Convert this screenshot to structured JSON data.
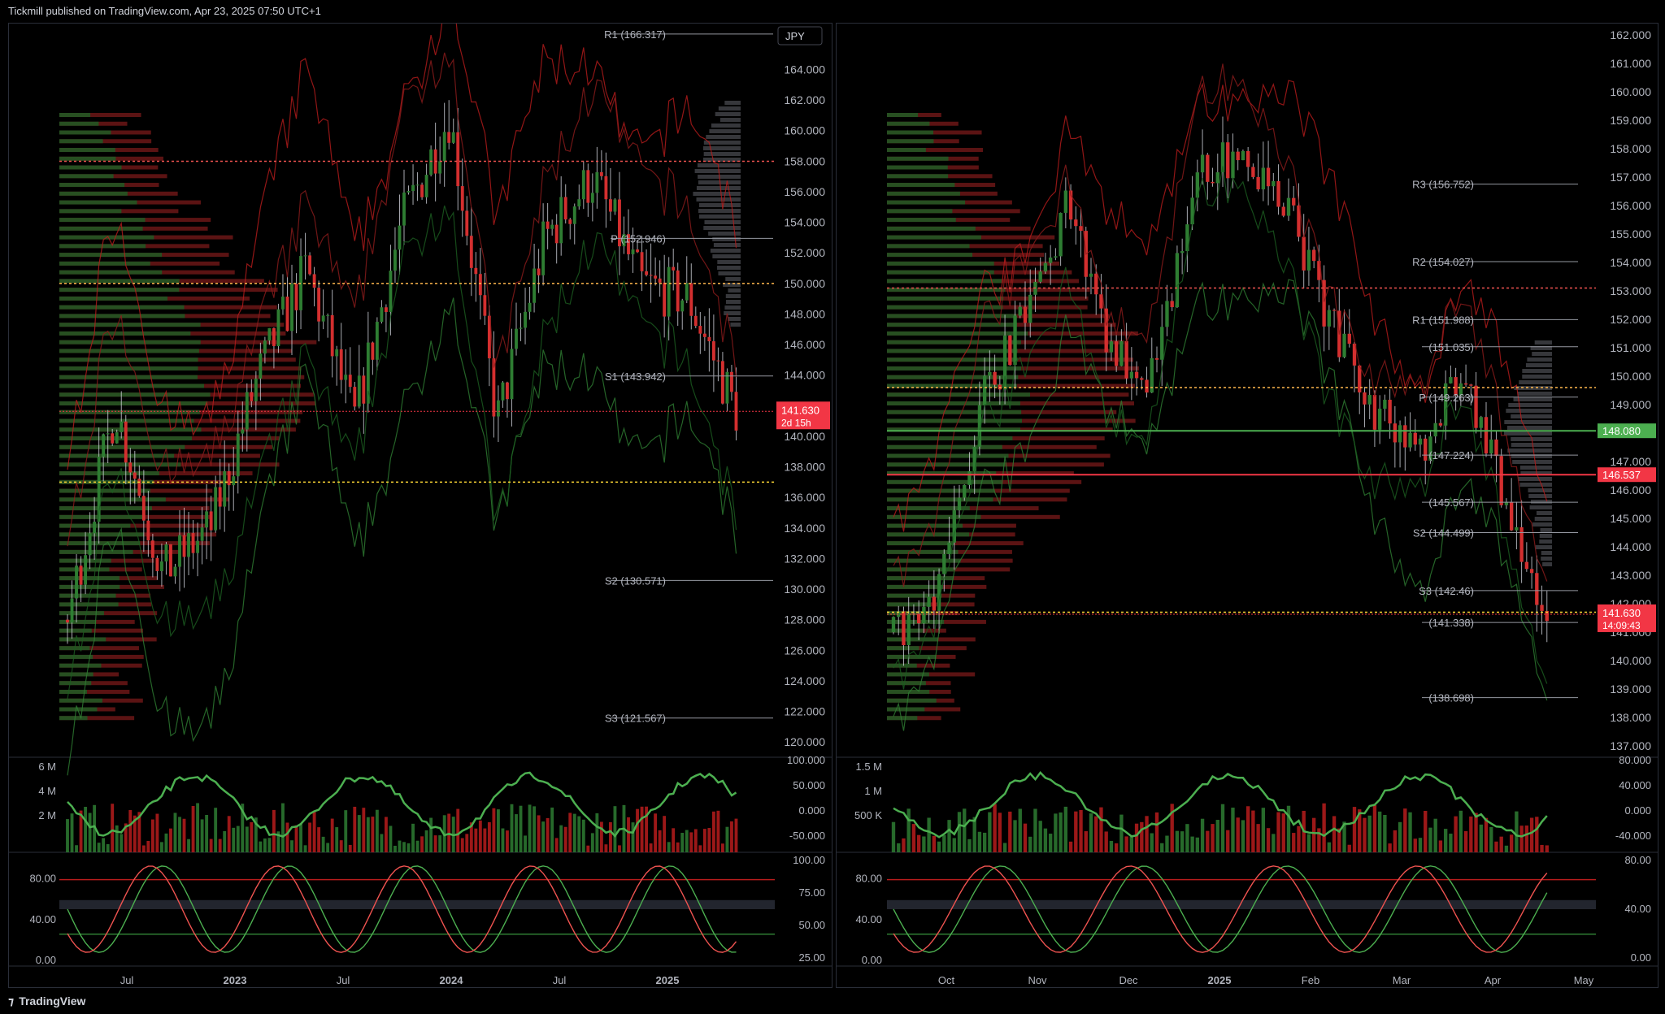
{
  "header": {
    "publisher": "Tickmill published on TradingView.com, Apr 23, 2025 07:50 UTC+1"
  },
  "footer": {
    "brand": "TradingView"
  },
  "colors": {
    "up": "#26a69a",
    "down": "#ef5350",
    "bg": "#000000",
    "grid": "#1e222d",
    "price_label": "#f23645",
    "green_label": "#4caf50"
  },
  "left_chart": {
    "symbol_badge": "JPY",
    "current_price": "141.630",
    "countdown": "2d 15h",
    "pivots": [
      {
        "label": "R1 (166.317)",
        "value": 166.317
      },
      {
        "label": "P (152.946)",
        "value": 152.946
      },
      {
        "label": "S1 (143.942)",
        "value": 143.942
      },
      {
        "label": "S2 (130.571)",
        "value": 130.571
      },
      {
        "label": "S3 (121.567)",
        "value": 121.567
      }
    ],
    "price_axis": [
      "164.000",
      "162.000",
      "160.000",
      "158.000",
      "156.000",
      "154.000",
      "152.000",
      "150.000",
      "148.000",
      "146.000",
      "144.000",
      "142.000",
      "140.000",
      "138.000",
      "136.000",
      "134.000",
      "132.000",
      "130.000",
      "128.000",
      "126.000",
      "124.000",
      "122.000",
      "120.000"
    ],
    "volume_left_axis": [
      "6 M",
      "4 M",
      "2 M"
    ],
    "volume_right_axis": [
      "100.000",
      "50.000",
      "0.000",
      "-50.000"
    ],
    "stoch_left_axis": [
      "80.00",
      "40.00",
      "0.00"
    ],
    "stoch_right_axis": [
      "100.00",
      "75.00",
      "50.00",
      "25.00"
    ],
    "time_axis": [
      "Jul",
      "2023",
      "Jul",
      "2024",
      "Jul",
      "2025"
    ]
  },
  "right_chart": {
    "current_price": "141.630",
    "countdown": "14:09:43",
    "levels": [
      {
        "label": "148.080",
        "value": 148.08,
        "color": "#4caf50"
      },
      {
        "label": "146.537",
        "value": 146.537,
        "color": "#f23645"
      }
    ],
    "pivots": [
      {
        "label": "R3 (156.752)",
        "value": 156.752
      },
      {
        "label": "R2 (154.027)",
        "value": 154.027
      },
      {
        "label": "R1 (151.988)",
        "value": 151.988
      },
      {
        "label": "(151.035)",
        "value": 151.035
      },
      {
        "label": "P (149.263)",
        "value": 149.263
      },
      {
        "label": "(147.224)",
        "value": 147.224
      },
      {
        "label": "(145.567)",
        "value": 145.567
      },
      {
        "label": "S2 (144.499)",
        "value": 144.499
      },
      {
        "label": "S3 (142.46)",
        "value": 142.46
      },
      {
        "label": "(141.338)",
        "value": 141.338
      },
      {
        "label": "(138.698)",
        "value": 138.698
      }
    ],
    "price_axis": [
      "162.000",
      "161.000",
      "160.000",
      "159.000",
      "158.000",
      "157.000",
      "156.000",
      "155.000",
      "154.000",
      "153.000",
      "152.000",
      "151.000",
      "150.000",
      "149.000",
      "148.000",
      "147.000",
      "146.000",
      "145.000",
      "144.000",
      "143.000",
      "142.000",
      "141.000",
      "140.000",
      "139.000",
      "138.000",
      "137.000"
    ],
    "volume_left_axis": [
      "1.5 M",
      "1 M",
      "500 K"
    ],
    "volume_right_axis": [
      "80.000",
      "40.000",
      "0.000",
      "-40.000"
    ],
    "stoch_left_axis": [
      "80.00",
      "40.00",
      "0.00"
    ],
    "stoch_right_axis": [
      "80.00",
      "40.00",
      "0.00"
    ],
    "time_axis": [
      "Oct",
      "Nov",
      "Dec",
      "2025",
      "Feb",
      "Mar",
      "Apr",
      "May"
    ]
  },
  "chart_data": [
    {
      "type": "line",
      "title": "",
      "x": [
        "2022-06",
        "2022-09",
        "2023-01",
        "2023-04",
        "2023-07",
        "2023-10",
        "2024-01",
        "2024-04",
        "2024-07",
        "2024-09",
        "2024-12",
        "2025-01",
        "2025-02",
        "2025-03",
        "2025-04"
      ],
      "series": [
        {
          "values": [
            128,
            142,
            131,
            134,
            144,
            151,
            141,
            154,
            161,
            141,
            153,
            157,
            150,
            149,
            141.63
          ]
        }
      ],
      "ylim": [
        119,
        167
      ]
    },
    {
      "type": "line",
      "title": "",
      "x": [
        "2024-09-10",
        "2024-09-25",
        "2024-10-15",
        "2024-11-01",
        "2024-11-15",
        "2024-12-01",
        "2024-12-15",
        "2025-01-01",
        "2025-01-10",
        "2025-01-25",
        "2025-02-10",
        "2025-02-25",
        "2025-03-10",
        "2025-03-28",
        "2025-04-05",
        "2025-04-22"
      ],
      "series": [
        {
          "values": [
            141,
            142,
            149,
            152,
            156,
            151,
            150,
            157,
            158,
            156,
            152,
            149,
            147,
            150,
            146,
            141.63
          ]
        }
      ],
      "ylim": [
        136.6,
        162.4
      ]
    }
  ]
}
